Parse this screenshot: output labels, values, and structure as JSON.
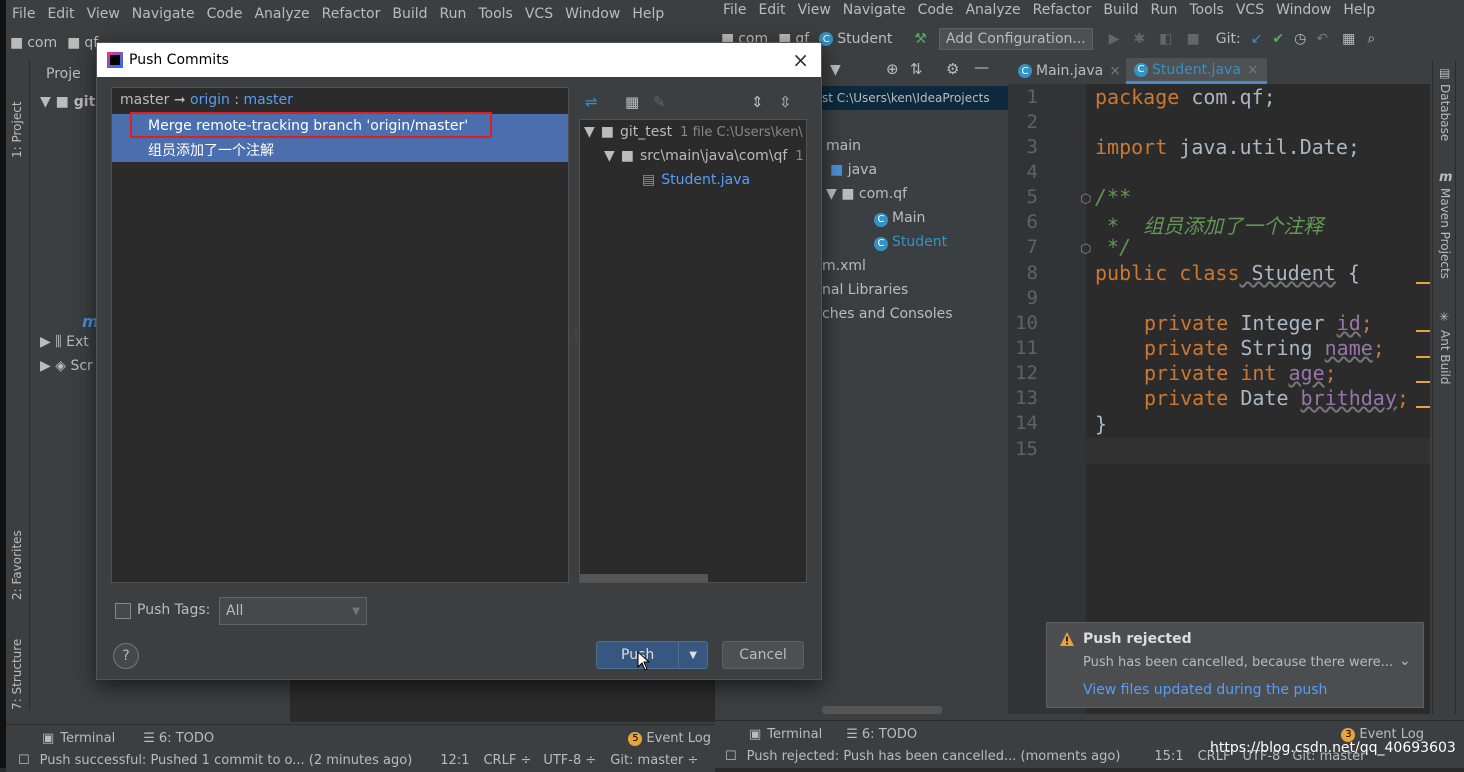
{
  "left_ide": {
    "menu": [
      "File",
      "Edit",
      "View",
      "Navigate",
      "Code",
      "Analyze",
      "Refactor",
      "Build",
      "Run",
      "Tools",
      "VCS",
      "Window",
      "Help"
    ],
    "nav": [
      "com",
      "qf",
      "Student",
      "Add Configuration...",
      "Git:"
    ],
    "project_label": "Proje",
    "tree_items": [
      "git",
      "Ext",
      "Scr"
    ],
    "side_tabs": [
      "1: Project",
      "2: Favorites",
      "7: Structure"
    ],
    "toolwin": {
      "terminal": "Terminal",
      "todo": "6: TODO",
      "event_log": "Event Log",
      "event_count": "5"
    },
    "status": {
      "message": "Push successful: Pushed 1 commit to o... (2 minutes ago)",
      "position": "12:1",
      "line_sep": "CRLF ÷",
      "encoding": "UTF-8 ÷",
      "branch": "Git: master ÷"
    }
  },
  "dialog": {
    "title": "Push Commits",
    "branch": {
      "local": "master",
      "remote": "origin",
      "remote_branch": "master"
    },
    "commits": [
      "Merge remote-tracking branch 'origin/master'",
      "组员添加了一个注解"
    ],
    "files": {
      "root": "git_test",
      "root_meta": "1 file  C:\\Users\\ken\\",
      "folder": "src\\main\\java\\com\\qf",
      "folder_meta": "1",
      "file": "Student.java"
    },
    "push_tags_label": "Push Tags:",
    "tags_option": "All",
    "push_button": "Push",
    "cancel_button": "Cancel",
    "help": "?"
  },
  "right_ide": {
    "menu": [
      "File",
      "Edit",
      "View",
      "Navigate",
      "Code",
      "Analyze",
      "Refactor",
      "Build",
      "Run",
      "Tools",
      "VCS",
      "Window",
      "Help"
    ],
    "nav": [
      "com",
      "qf",
      "Student"
    ],
    "add_config": "Add Configuration...",
    "git_label": "Git:",
    "project_path": "st  C:\\Users\\ken\\IdeaProjects",
    "tree": [
      "main",
      "java",
      "com.qf",
      "Main",
      "Student",
      "m.xml",
      "nal Libraries",
      "ches and Consoles"
    ],
    "tabs": [
      "Main.java",
      "Student.java"
    ],
    "line_numbers": [
      "1",
      "2",
      "3",
      "4",
      "5",
      "6",
      "7",
      "8",
      "9",
      "10",
      "11",
      "12",
      "13",
      "14",
      "15"
    ],
    "code": {
      "l1_kw": "package",
      "l1_rest": " com.qf;",
      "l3_kw": "import",
      "l3_rest": " java.util.Date;",
      "l5": "/**",
      "l6": " *  组员添加了一个注释",
      "l7": " */",
      "l8_kw": "public class",
      "l8_name": " Student",
      "l8_rest": " {",
      "l10_kw": "private",
      "l10_type": " Integer ",
      "l10_f": "id",
      "l10_end": ";",
      "l11_kw": "private",
      "l11_type": " String ",
      "l11_f": "name",
      "l11_end": ";",
      "l12_kw": "private int",
      "l12_type": " ",
      "l12_f": "age",
      "l12_end": ";",
      "l13_kw": "private",
      "l13_type": " Date ",
      "l13_f": "brithday",
      "l13_end": ";",
      "l14": "}"
    },
    "side_tabs": [
      "Database",
      "Maven Projects",
      "Ant Build"
    ],
    "notification": {
      "title": "Push rejected",
      "body": "Push has been cancelled, because there were...",
      "link": "View files updated during the push"
    },
    "toolwin": {
      "terminal": "Terminal",
      "todo": "6: TODO",
      "event_log": "Event Log",
      "event_count": "3"
    },
    "status": {
      "message": "Push rejected: Push has been cancelled... (moments ago)",
      "position": "15:1",
      "line_sep": "CRLF",
      "encoding": "UTF-8",
      "branch": "Git: master"
    },
    "watermark": "https://blog.csdn.net/qq_40693603"
  }
}
